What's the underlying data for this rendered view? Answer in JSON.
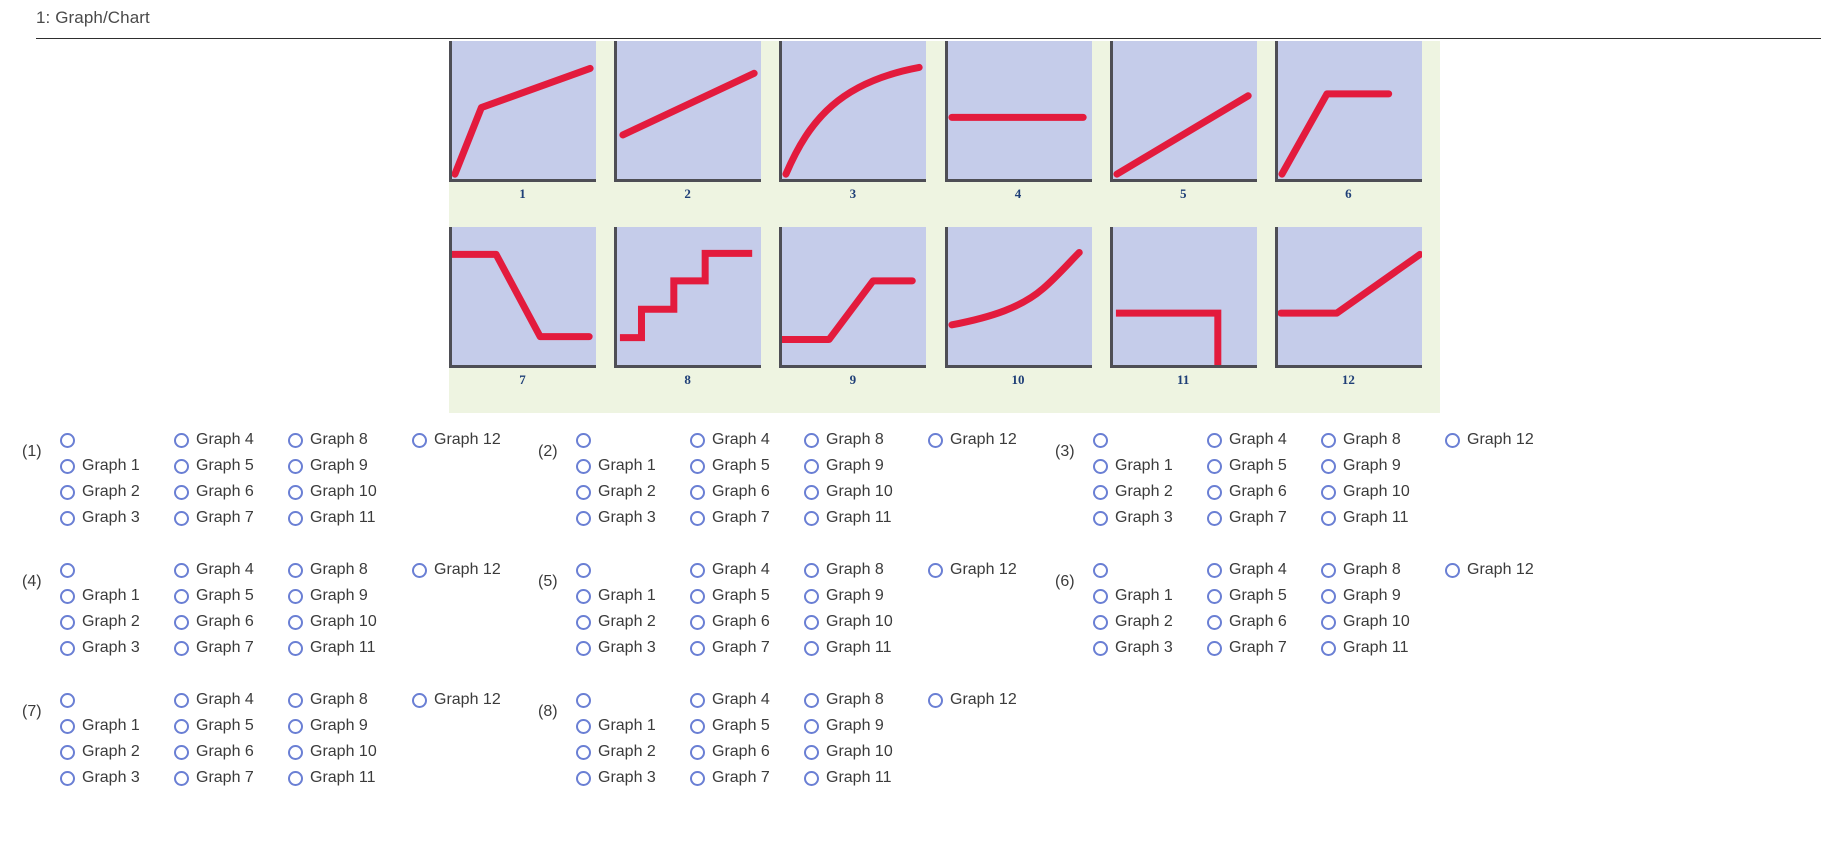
{
  "header": {
    "question_number": "1",
    "title": "1: Graph/Chart"
  },
  "figure": {
    "panel_background": "#eef4e1",
    "plot_background": "#c5ccea",
    "line_color": "#e31b3d",
    "axis_color": "#4e4e55",
    "label_color": "#1f3f77",
    "graphs": [
      {
        "label": "1",
        "description": "steep rise then shallower linear rise (kinked increasing line)"
      },
      {
        "label": "2",
        "description": "straight line with gentle positive slope"
      },
      {
        "label": "3",
        "description": "concave increasing curve, flattening at the top"
      },
      {
        "label": "4",
        "description": "horizontal flat line at mid height"
      },
      {
        "label": "5",
        "description": "straight diagonal line rising from origin"
      },
      {
        "label": "6",
        "description": "steep rise then flat horizontal plateau"
      },
      {
        "label": "7",
        "description": "flat, then decreasing ramp down, then flat at low level"
      },
      {
        "label": "8",
        "description": "rising step function with four steps"
      },
      {
        "label": "9",
        "description": "flat low, then rising ramp, then flat high plateau"
      },
      {
        "label": "10",
        "description": "convex increasing curve, steepening at the right"
      },
      {
        "label": "11",
        "description": "flat horizontal line then a vertical drop to zero at the right"
      },
      {
        "label": "12",
        "description": "flat low, then rising straight ramp to the right edge"
      }
    ]
  },
  "answers": {
    "option_labels": [
      "",
      "Graph 1",
      "Graph 2",
      "Graph 3",
      "Graph 4",
      "Graph 5",
      "Graph 6",
      "Graph 7",
      "Graph 8",
      "Graph 9",
      "Graph 10",
      "Graph 11",
      "Graph 12",
      "",
      "",
      ""
    ],
    "groups": [
      {
        "index": "(1)"
      },
      {
        "index": "(2)"
      },
      {
        "index": "(3)"
      },
      {
        "index": "(4)"
      },
      {
        "index": "(5)"
      },
      {
        "index": "(6)"
      },
      {
        "index": "(7)"
      },
      {
        "index": "(8)"
      }
    ]
  }
}
